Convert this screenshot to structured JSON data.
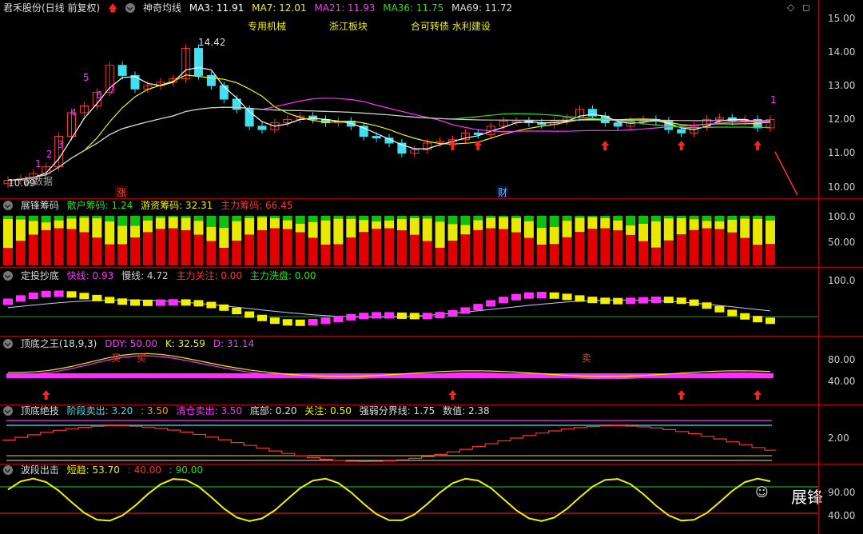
{
  "main": {
    "stock": "君禾股份(日线 前复权)",
    "indicator": "神奇均线",
    "ma3": "MA3: 11.91",
    "ma7": "MA7: 12.01",
    "ma21": "MA21: 11.93",
    "ma36": "MA36: 11.75",
    "ma69": "MA69: 11.72",
    "tags": [
      "专用机械",
      "浙江板块",
      "合可转债 水利建设"
    ],
    "high_label": "14.42",
    "low_label": "10.09",
    "number_labels": [
      "1",
      "2",
      "3",
      "4",
      "5",
      "6",
      "7",
      "1"
    ],
    "badge_rise": "涨",
    "badge_fin": "财",
    "overlay": "跨数据",
    "y_ticks": [
      "15.00",
      "14.00",
      "13.00",
      "12.00",
      "11.00",
      "10.00"
    ]
  },
  "chips": {
    "title": "展锋筹码",
    "retail": "散户筹码: 1.24",
    "hot": "游资筹码: 32.31",
    "main": "主力筹码: 66.45",
    "ticks": [
      "100.0",
      "50.00"
    ]
  },
  "dingtou": {
    "title": "定投抄底",
    "fast": "快线: 0.93",
    "slow": "慢线: 4.72",
    "attn": "主力关注: 0.00",
    "wash": "主力洗盘: 0.00",
    "ticks": [
      "100.0"
    ]
  },
  "topbottom": {
    "title": "顶底之王(18,9,3)",
    "ddy": "DDY: 50.00",
    "k": "K: 32.59",
    "d": "D: 31.14",
    "ticks": [
      "80.00",
      "40.00"
    ],
    "mark_buy": "买",
    "mark_sell": "卖"
  },
  "juji": {
    "title": "顶底绝技",
    "stage": "阶段卖出: 3.20",
    "stage2": ": 3.50",
    "clear": "清仓卖出: 3.50",
    "bottom": "底部: 0.20",
    "attn": "关注: 0.50",
    "strength": "强弱分界线: 1.75",
    "value": "数值: 2.38",
    "ticks": [
      "2.00"
    ]
  },
  "wave": {
    "title": "波段出击",
    "short": "短趋: 53.70",
    "v40": ": 40.00",
    "v90": ": 90.00",
    "ticks": [
      "90.00",
      "40.00"
    ]
  },
  "watermark": "展锋",
  "colors": {
    "red": "#ff2020",
    "cyan": "#40e0f0",
    "yellow": "#f0f000",
    "magenta": "#ff30ff",
    "green": "#20d020"
  }
}
